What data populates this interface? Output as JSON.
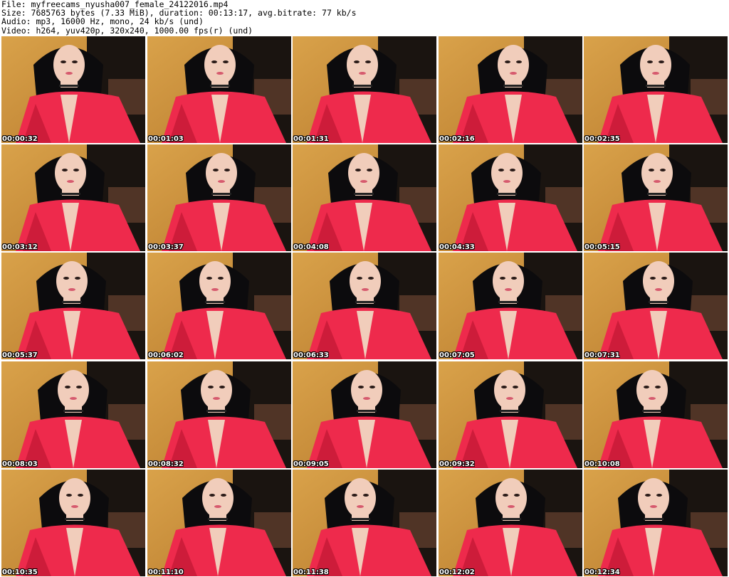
{
  "header": {
    "file": "File: myfreecams_nyusha007_female_24122016.mp4",
    "size": "Size: 7685763 bytes (7.33 MiB), duration: 00:13:17, avg.bitrate: 77 kb/s",
    "audio": "Audio: mp3, 16000 Hz, mono, 24 kb/s (und)",
    "video": "Video: h264, yuv420p, 320x240, 1000.00 fps(r) (und)"
  },
  "thumbnails": [
    {
      "timestamp": "00:00:32"
    },
    {
      "timestamp": "00:01:03"
    },
    {
      "timestamp": "00:01:31"
    },
    {
      "timestamp": "00:02:16"
    },
    {
      "timestamp": "00:02:35"
    },
    {
      "timestamp": "00:03:12"
    },
    {
      "timestamp": "00:03:37"
    },
    {
      "timestamp": "00:04:08"
    },
    {
      "timestamp": "00:04:33"
    },
    {
      "timestamp": "00:05:15"
    },
    {
      "timestamp": "00:05:37"
    },
    {
      "timestamp": "00:06:02"
    },
    {
      "timestamp": "00:06:33"
    },
    {
      "timestamp": "00:07:05"
    },
    {
      "timestamp": "00:07:31"
    },
    {
      "timestamp": "00:08:03"
    },
    {
      "timestamp": "00:08:32"
    },
    {
      "timestamp": "00:09:05"
    },
    {
      "timestamp": "00:09:32"
    },
    {
      "timestamp": "00:10:08"
    },
    {
      "timestamp": "00:10:35"
    },
    {
      "timestamp": "00:11:10"
    },
    {
      "timestamp": "00:11:38"
    },
    {
      "timestamp": "00:12:02"
    },
    {
      "timestamp": "00:12:34"
    }
  ],
  "colors": {
    "wall": "#d9a24a",
    "wall_dark": "#b7792c",
    "background_dark": "#1a1410",
    "couch": "#5a3a2a",
    "hair": "#0c0b0d",
    "skin": "#f1cdbb",
    "top": "#ee2a4c",
    "top_shadow": "#b8142f"
  }
}
